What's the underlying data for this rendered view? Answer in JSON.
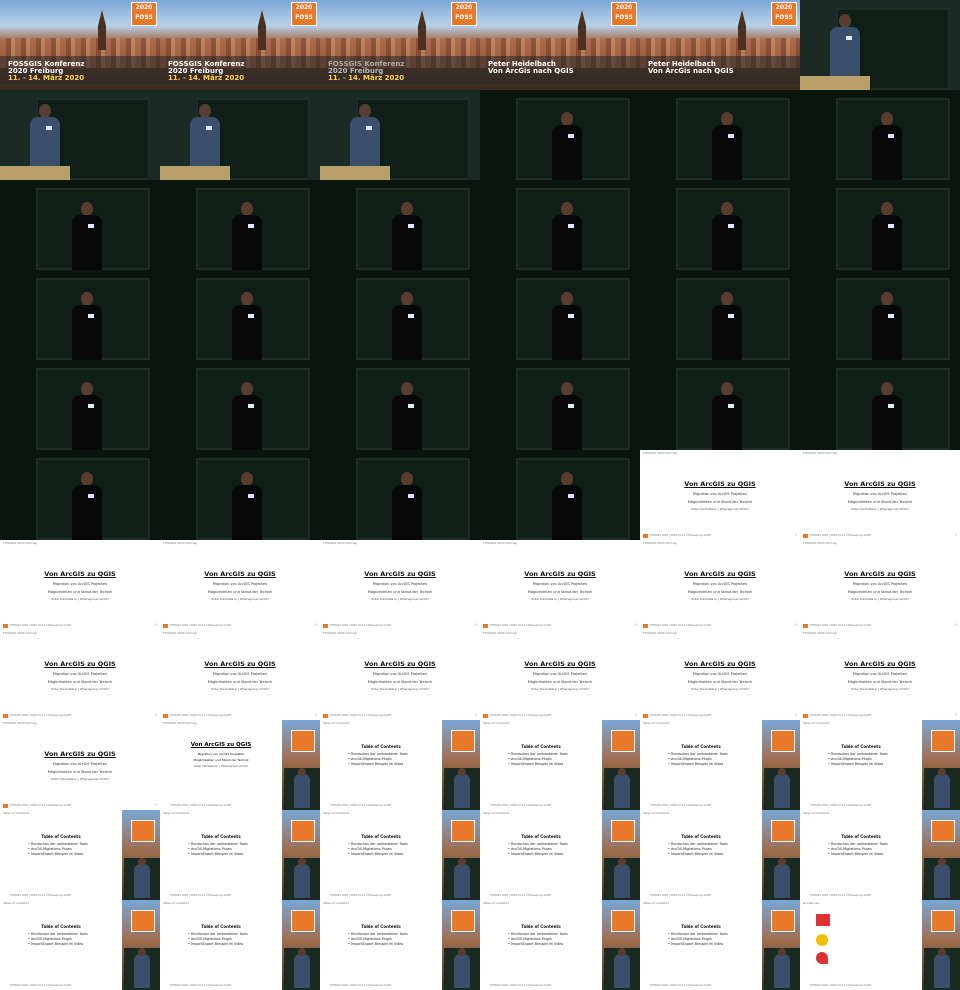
{
  "intro": {
    "logo_year": "2020",
    "logo_text": "FOSS",
    "logo_letter": "G",
    "conference": "FOSSGIS Konferenz",
    "city": "2020 Freiburg",
    "dates": "11. - 14. März 2020",
    "speaker": "Peter Heidelbach",
    "talk": "Von ArcGis nach QGIS"
  },
  "slide": {
    "header": "FOSSGIS 2020 Vortrag",
    "title": "Von ArcGIS zu QGIS",
    "subtitle1": "Migration von ArcGIS Projekten",
    "subtitle2": "Möglichkeiten und Stand der Technik",
    "author": "Peter Heidelbach | Wheregroup GmbH",
    "footer": "FOSSGIS 2020 | 2020-03-12 | Wheregroup GmbH"
  },
  "toc": {
    "header": "Table of Contents",
    "title": "Table of Contents",
    "items": [
      "Rundschau der vorhandenen Tools",
      "ArcGIS-Migrations-Plugin",
      "Import/Export Beispiel im Video"
    ]
  },
  "tools_header": "Rundschau",
  "tiles": [
    "intro",
    "intro",
    "intro-fade",
    "intro-speaker",
    "intro-speaker",
    "speaker-light",
    "speaker-light",
    "speaker-light",
    "speaker-light",
    "speaker",
    "speaker",
    "speaker",
    "speaker",
    "speaker",
    "speaker",
    "speaker",
    "speaker",
    "speaker",
    "speaker",
    "speaker",
    "speaker",
    "speaker",
    "speaker",
    "speaker",
    "speaker",
    "speaker",
    "speaker",
    "speaker",
    "speaker",
    "speaker",
    "speaker",
    "speaker",
    "speaker",
    "speaker",
    "slide",
    "slide",
    "slide",
    "slide",
    "slide",
    "slide",
    "slide",
    "slide",
    "slide",
    "slide",
    "slide",
    "slide",
    "slide",
    "slide",
    "slide",
    "comp-title",
    "comp-toc",
    "comp-toc",
    "comp-toc",
    "comp-toc",
    "comp-toc",
    "comp-toc",
    "comp-toc",
    "comp-toc",
    "comp-toc",
    "comp-toc",
    "comp-toc",
    "comp-toc",
    "comp-toc",
    "comp-toc",
    "comp-toc",
    "comp-tools"
  ]
}
